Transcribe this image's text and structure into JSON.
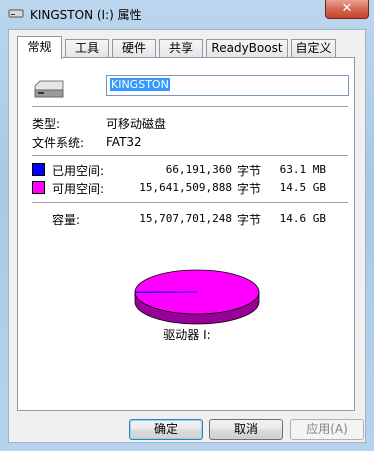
{
  "window": {
    "title": "KINGSTON (I:) 属性",
    "close_glyph": "✕"
  },
  "tabs": [
    {
      "label": "常规",
      "active": true
    },
    {
      "label": "工具"
    },
    {
      "label": "硬件"
    },
    {
      "label": "共享"
    },
    {
      "label": "ReadyBoost"
    },
    {
      "label": "自定义"
    }
  ],
  "general": {
    "volume_name": "KINGSTON",
    "type_label": "类型:",
    "type_value": "可移动磁盘",
    "fs_label": "文件系统:",
    "fs_value": "FAT32",
    "used": {
      "label": "已用空间:",
      "bytes": "66,191,360",
      "unit": "字节",
      "size": "63.1 MB",
      "color": "#0000ff"
    },
    "free": {
      "label": "可用空间:",
      "bytes": "15,641,509,888",
      "unit": "字节",
      "size": "14.5 GB",
      "color": "#ff00ff"
    },
    "capacity": {
      "label": "容量:",
      "bytes": "15,707,701,248",
      "unit": "字节",
      "size": "14.6 GB"
    },
    "used_fraction": 0.0042,
    "drive_label": "驱动器 I:"
  },
  "buttons": {
    "ok": "确定",
    "cancel": "取消",
    "apply": "应用(A)"
  }
}
